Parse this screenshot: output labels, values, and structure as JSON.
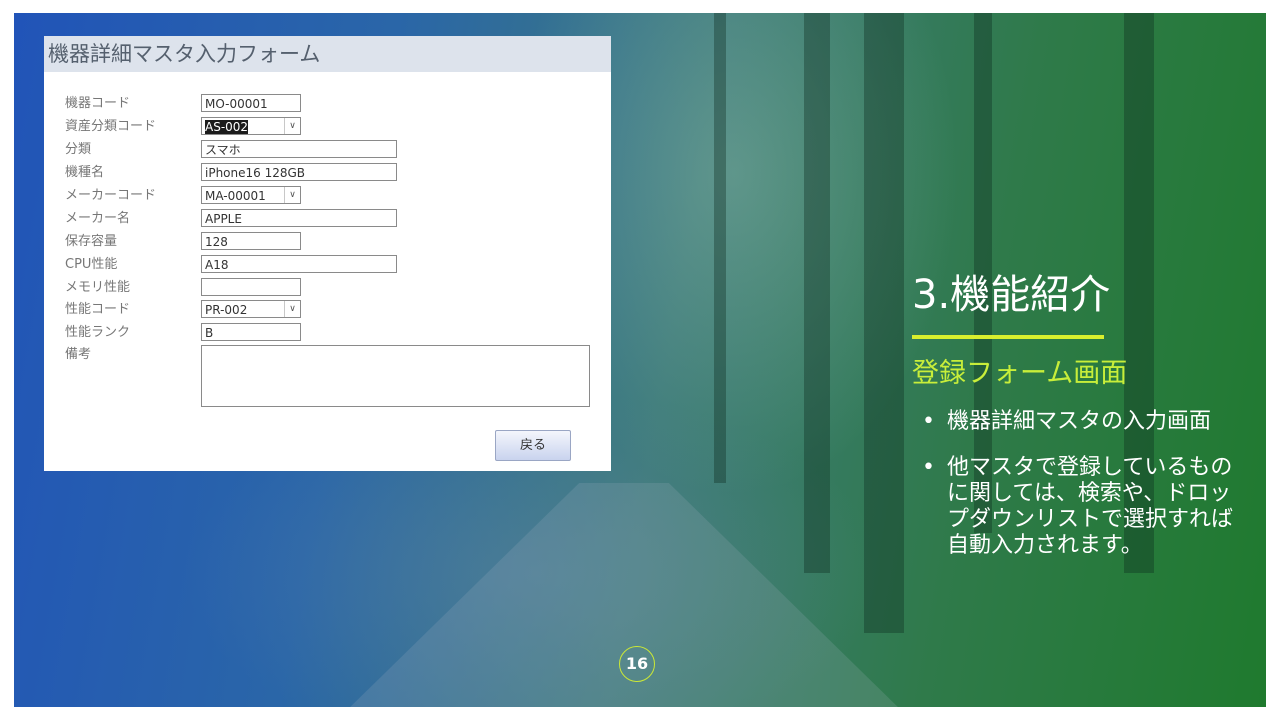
{
  "form": {
    "title": "機器詳細マスタ入力フォーム",
    "fields": [
      {
        "label": "機器コード",
        "value": "MO-00001"
      },
      {
        "label": "資産分類コード",
        "value": "AS-002"
      },
      {
        "label": "分類",
        "value": "スマホ"
      },
      {
        "label": "機種名",
        "value": "iPhone16 128GB"
      },
      {
        "label": "メーカーコード",
        "value": "MA-00001"
      },
      {
        "label": "メーカー名",
        "value": "APPLE"
      },
      {
        "label": "保存容量",
        "value": "128"
      },
      {
        "label": "CPU性能",
        "value": "A18"
      },
      {
        "label": "メモリ性能",
        "value": ""
      },
      {
        "label": "性能コード",
        "value": "PR-002"
      },
      {
        "label": "性能ランク",
        "value": "B"
      },
      {
        "label": "備考",
        "value": ""
      }
    ],
    "back_label": "戻る",
    "dropdown_icon": "chevron-down-icon"
  },
  "slide": {
    "section_title": "3.機能紹介",
    "subtitle": "登録フォーム画面",
    "bullet_glyph": "•",
    "bullets": [
      "機器詳細マスタの入力画面",
      "他マスタで登録しているものに関しては、検索や、ドロップダウンリストで選択すれば自動入力されます。"
    ],
    "page_number": "16",
    "colors": {
      "accent": "#d9ef2e",
      "subtitle": "#c8ee3a",
      "background_left": "#2154b8",
      "background_right": "#1f7a2e"
    }
  }
}
